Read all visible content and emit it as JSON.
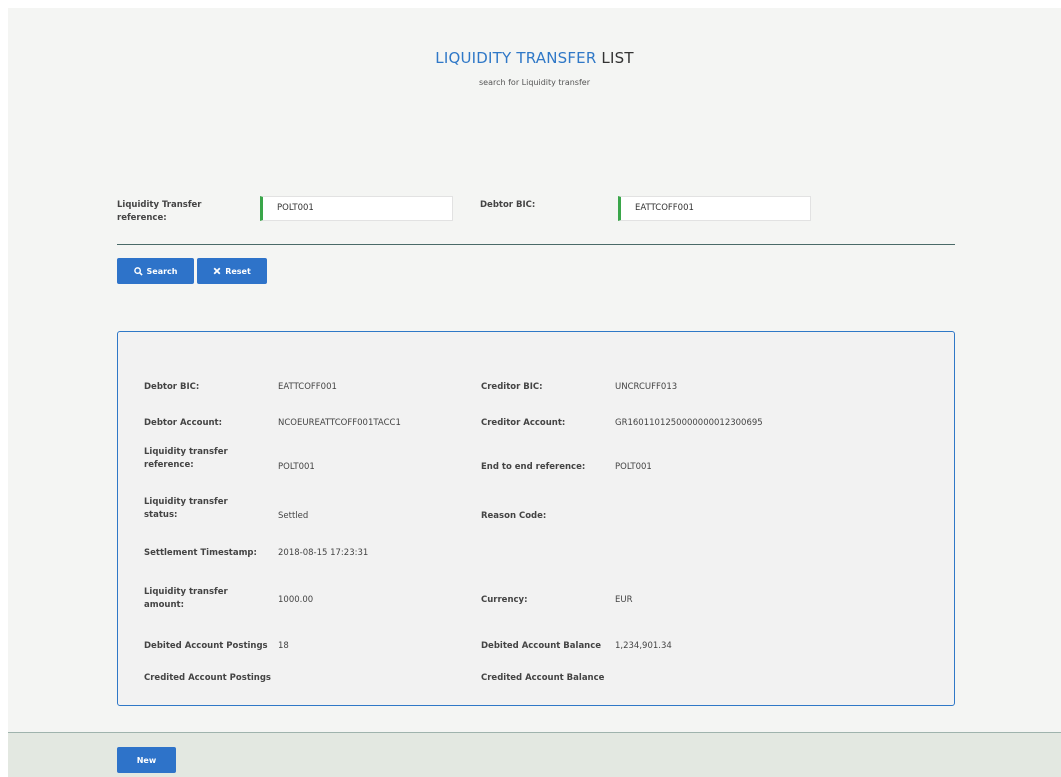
{
  "header": {
    "title_highlight": "LIQUIDITY TRANSFER",
    "title_rest": " LIST",
    "subtitle": "search for Liquidity transfer"
  },
  "search": {
    "lt_reference_label": "Liquidity Transfer reference:",
    "lt_reference_value": "POLT001",
    "debtor_bic_label": "Debtor BIC:",
    "debtor_bic_value": "EATTCOFF001",
    "search_button": "Search",
    "reset_button": "Reset"
  },
  "details": {
    "debtor_bic_label": "Debtor BIC:",
    "debtor_bic_value": "EATTCOFF001",
    "creditor_bic_label": "Creditor BIC:",
    "creditor_bic_value": "UNCRCUFF013",
    "debtor_account_label": "Debtor Account:",
    "debtor_account_value": "NCOEUREATTCOFF001TACC1",
    "creditor_account_label": "Creditor Account:",
    "creditor_account_value": "GR1601101250000000012300695",
    "lt_reference_label": "Liquidity transfer reference:",
    "lt_reference_value": "POLT001",
    "e2e_reference_label": "End to end reference:",
    "e2e_reference_value": "POLT001",
    "lt_status_label": "Liquidity transfer status:",
    "lt_status_value": "Settled",
    "reason_code_label": "Reason Code:",
    "settlement_ts_label": "Settlement Timestamp:",
    "settlement_ts_value": "2018-08-15 17:23:31",
    "lt_amount_label": "Liquidity transfer amount:",
    "lt_amount_value": "1000.00",
    "currency_label": "Currency:",
    "currency_value": "EUR",
    "debited_postings_label": "Debited Account Postings",
    "debited_postings_value": "18",
    "debited_balance_label": "Debited Account Balance",
    "debited_balance_value": "1,234,901.34",
    "credited_postings_label": "Credited Account Postings",
    "credited_balance_label": "Credited Account Balance"
  },
  "footer": {
    "new_button": "New"
  },
  "colors": {
    "accent_blue": "#2e73c9",
    "field_marker_green": "#3aa64a"
  }
}
